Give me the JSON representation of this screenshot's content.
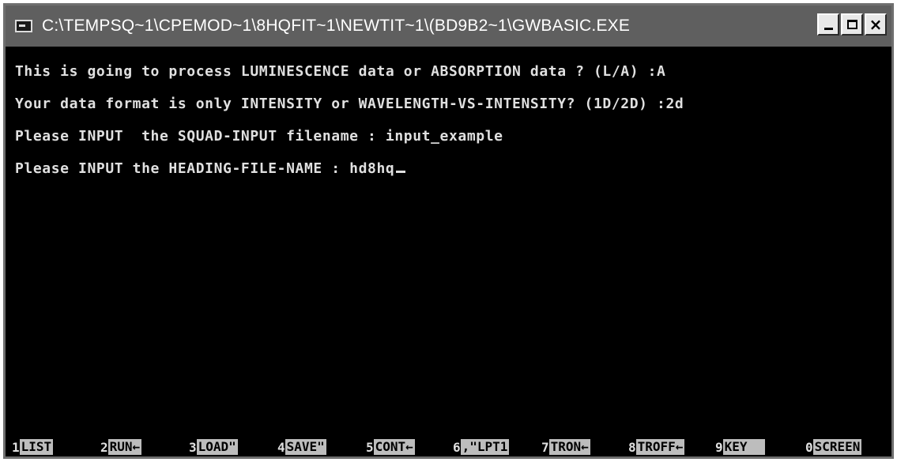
{
  "window": {
    "title": "C:\\TEMPSQ~1\\CPEMOD~1\\8HQFIT~1\\NEWTIT~1\\(BD9B2~1\\GWBASIC.EXE",
    "buttons": {
      "minimize": "_",
      "maximize": "□",
      "close": "×"
    }
  },
  "console": {
    "lines": [
      "This is going to process LUMINESCENCE data or ABSORPTION data ? (L/A) :A",
      "Your data format is only INTENSITY or WAVELENGTH-VS-INTENSITY? (1D/2D) :2d",
      "Please INPUT  the SQUAD-INPUT filename : input_example",
      "Please INPUT the HEADING-FILE-NAME : hd8hq"
    ]
  },
  "function_keys": [
    {
      "num": "1",
      "label": "LIST"
    },
    {
      "num": "2",
      "label": "RUN←"
    },
    {
      "num": "3",
      "label": "LOAD\""
    },
    {
      "num": "4",
      "label": "SAVE\""
    },
    {
      "num": "5",
      "label": "CONT←"
    },
    {
      "num": "6",
      "label": ",\"LPT1"
    },
    {
      "num": "7",
      "label": "TRON←"
    },
    {
      "num": "8",
      "label": "TROFF←"
    },
    {
      "num": "9",
      "label": "KEY"
    },
    {
      "num": "0",
      "label": "SCREEN"
    }
  ],
  "colors": {
    "console_bg": "#000000",
    "console_text": "#e0e0e0",
    "titlebar": "#5f5f5f",
    "fkey_label_bg": "#bdbdbd"
  }
}
